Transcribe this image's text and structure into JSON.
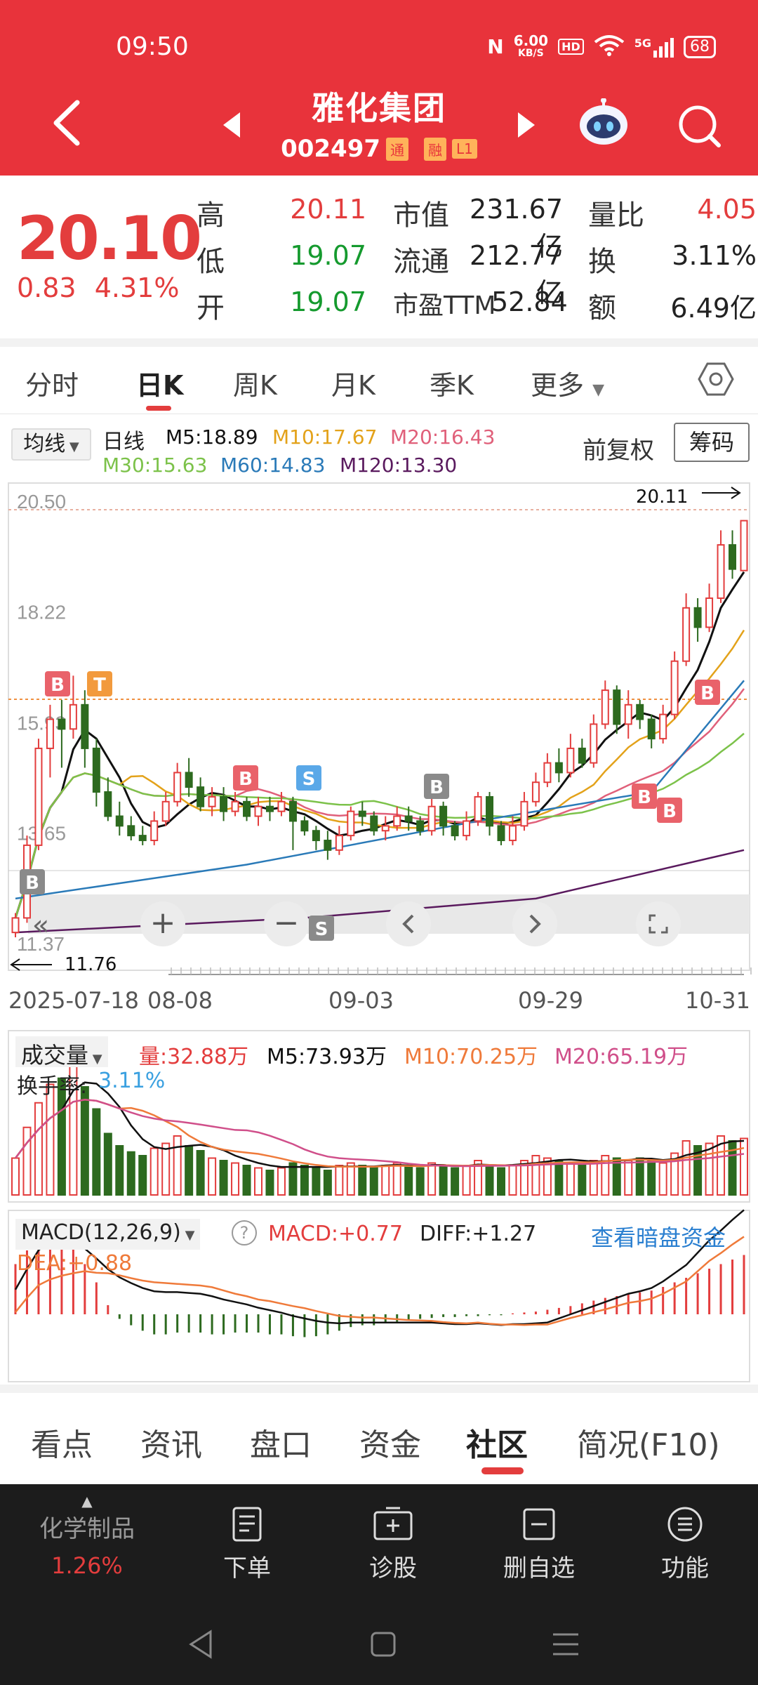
{
  "status_bar": {
    "time": "09:50",
    "net_speed": "6.00",
    "net_unit": "KB/S",
    "hd": "HD",
    "signal": "5G",
    "battery": "68"
  },
  "header": {
    "title": "雅化集团",
    "code": "002497",
    "tags": [
      "通",
      "融",
      "L1"
    ]
  },
  "quote": {
    "price": "20.10",
    "change": "0.83",
    "change_pct": "4.31%",
    "rows": [
      {
        "l1": "高",
        "v1": "20.11",
        "l2": "市值",
        "v2": "231.67亿",
        "l3": "量比",
        "v3": "4.05"
      },
      {
        "l1": "低",
        "v1": "19.07",
        "l2": "流通",
        "v2": "212.77亿",
        "l3": "换",
        "v3": "3.11%"
      },
      {
        "l1": "开",
        "v1": "19.07",
        "l2": "市盈TTM",
        "v2": "52.84",
        "l3": "额",
        "v3": "6.49亿"
      }
    ]
  },
  "tabs": [
    "分时",
    "日K",
    "周K",
    "月K",
    "季K",
    "更多"
  ],
  "active_tab": "日K",
  "ma_legend": {
    "selector": "均线",
    "period": "日线",
    "m5": "M5:18.89",
    "m10": "M10:17.67",
    "m20": "M20:16.43",
    "m30": "M30:15.63",
    "m60": "M60:14.83",
    "m120": "M120:13.30",
    "adjust": "前复权",
    "chips": "筹码"
  },
  "colors": {
    "up": "#e33d3d",
    "down": "#2d6a1f",
    "m5": "#111111",
    "m10": "#e3a21a",
    "m20": "#e0607a",
    "m30": "#7cc24a",
    "m60": "#2a7ab8",
    "m120": "#5a1a5e"
  },
  "chart_data": {
    "type": "candlestick",
    "y_ticks": [
      "20.50",
      "18.22",
      "15.93",
      "13.65",
      "11.37"
    ],
    "ylim": [
      11.37,
      20.5
    ],
    "x_labels": [
      "2025-07-18",
      "08-08",
      "09-03",
      "09-29",
      "10-31"
    ],
    "high_label": "20.11",
    "low_label": "11.76",
    "candles": [
      [
        11.6,
        11.9,
        11.5,
        12.0
      ],
      [
        11.9,
        13.4,
        11.8,
        13.6
      ],
      [
        13.4,
        15.4,
        13.3,
        15.6
      ],
      [
        15.4,
        16.0,
        14.8,
        16.3
      ],
      [
        16.0,
        15.8,
        15.0,
        16.4
      ],
      [
        15.8,
        16.3,
        15.6,
        16.9
      ],
      [
        16.3,
        15.4,
        15.0,
        16.6
      ],
      [
        15.4,
        14.5,
        14.2,
        15.6
      ],
      [
        14.5,
        14.0,
        13.9,
        14.8
      ],
      [
        14.0,
        13.8,
        13.6,
        14.3
      ],
      [
        13.8,
        13.6,
        13.5,
        14.0
      ],
      [
        13.6,
        13.5,
        13.4,
        13.8
      ],
      [
        13.5,
        13.9,
        13.4,
        14.1
      ],
      [
        13.9,
        14.3,
        13.8,
        14.5
      ],
      [
        14.3,
        14.9,
        14.2,
        15.1
      ],
      [
        14.9,
        14.6,
        14.4,
        15.2
      ],
      [
        14.6,
        14.2,
        14.1,
        14.8
      ],
      [
        14.2,
        14.4,
        14.0,
        14.6
      ],
      [
        14.4,
        14.1,
        13.9,
        14.6
      ],
      [
        14.1,
        14.3,
        14.0,
        14.5
      ],
      [
        14.3,
        14.0,
        13.9,
        14.4
      ],
      [
        14.0,
        14.2,
        13.8,
        14.4
      ],
      [
        14.2,
        14.1,
        13.9,
        14.4
      ],
      [
        14.1,
        14.3,
        14.0,
        14.5
      ],
      [
        14.3,
        13.9,
        13.3,
        14.4
      ],
      [
        13.9,
        13.7,
        13.6,
        14.0
      ],
      [
        13.7,
        13.5,
        13.3,
        13.8
      ],
      [
        13.5,
        13.3,
        13.1,
        13.7
      ],
      [
        13.3,
        13.6,
        13.2,
        13.8
      ],
      [
        13.6,
        14.1,
        13.5,
        14.2
      ],
      [
        14.1,
        14.0,
        13.8,
        14.3
      ],
      [
        14.0,
        13.7,
        13.6,
        14.1
      ],
      [
        13.7,
        13.8,
        13.5,
        14.0
      ],
      [
        13.8,
        14.0,
        13.7,
        14.2
      ],
      [
        14.0,
        13.9,
        13.7,
        14.2
      ],
      [
        13.9,
        13.7,
        13.6,
        14.0
      ],
      [
        13.7,
        14.2,
        13.6,
        14.4
      ],
      [
        14.2,
        13.8,
        13.6,
        14.3
      ],
      [
        13.8,
        13.6,
        13.5,
        13.9
      ],
      [
        13.6,
        13.9,
        13.5,
        14.1
      ],
      [
        13.9,
        14.4,
        13.8,
        14.5
      ],
      [
        14.4,
        13.8,
        13.6,
        14.5
      ],
      [
        13.8,
        13.5,
        13.4,
        13.9
      ],
      [
        13.5,
        13.8,
        13.4,
        14.0
      ],
      [
        13.8,
        14.3,
        13.7,
        14.5
      ],
      [
        14.3,
        14.7,
        14.2,
        14.9
      ],
      [
        14.7,
        15.1,
        14.6,
        15.3
      ],
      [
        15.1,
        14.9,
        14.7,
        15.4
      ],
      [
        14.9,
        15.4,
        14.8,
        15.7
      ],
      [
        15.4,
        15.1,
        15.0,
        15.6
      ],
      [
        15.1,
        15.9,
        15.0,
        16.1
      ],
      [
        15.9,
        16.6,
        15.8,
        16.8
      ],
      [
        16.6,
        15.9,
        15.7,
        16.7
      ],
      [
        15.9,
        16.3,
        15.6,
        16.6
      ],
      [
        16.3,
        16.0,
        15.8,
        16.4
      ],
      [
        16.0,
        15.6,
        15.4,
        16.1
      ],
      [
        15.6,
        16.1,
        15.5,
        16.3
      ],
      [
        16.1,
        17.2,
        16.0,
        17.4
      ],
      [
        17.2,
        18.3,
        17.1,
        18.6
      ],
      [
        18.3,
        17.9,
        17.6,
        18.5
      ],
      [
        17.9,
        18.5,
        17.8,
        18.8
      ],
      [
        18.5,
        19.6,
        18.4,
        19.9
      ],
      [
        19.6,
        19.1,
        18.9,
        19.9
      ],
      [
        19.07,
        20.1,
        19.07,
        20.11
      ]
    ],
    "ma_note": "M5 M10 M20 M30 M60 M120"
  },
  "chart_controls": {
    "zoom_in": "+",
    "zoom_out": "−"
  },
  "signals": [
    {
      "t": "B",
      "color": "#e9626a"
    },
    {
      "t": "T",
      "color": "#f29a3d"
    },
    {
      "t": "B",
      "color": "#e9626a"
    },
    {
      "t": "S",
      "color": "#5aa8e8"
    },
    {
      "t": "B",
      "color": "#8a8a8a"
    },
    {
      "t": "S",
      "color": "#8a8a8a"
    },
    {
      "t": "B",
      "color": "#8a8a8a"
    },
    {
      "t": "B",
      "color": "#e9626a"
    },
    {
      "t": "B",
      "color": "#e9626a"
    },
    {
      "t": "B",
      "color": "#e9626a"
    }
  ],
  "volume": {
    "selector": "成交量",
    "vol": "量:32.88万",
    "m5": "M5:73.93万",
    "m10": "M10:70.25万",
    "m20": "M20:65.19万",
    "turnover_label": "换手率:",
    "turnover": "3.11%"
  },
  "macd": {
    "selector": "MACD(12,26,9)",
    "macd": "MACD:+0.77",
    "diff": "DIFF:+1.27",
    "dea": "DEA:+0.88",
    "link": "查看暗盘资金"
  },
  "bottom_tabs": [
    "看点",
    "资讯",
    "盘口",
    "资金",
    "社区",
    "简况(F10)"
  ],
  "active_bottom_tab": "社区",
  "toolbar": {
    "sector": "化学制品",
    "sector_pct": "1.26%",
    "items": [
      "下单",
      "诊股",
      "删自选",
      "功能"
    ]
  }
}
